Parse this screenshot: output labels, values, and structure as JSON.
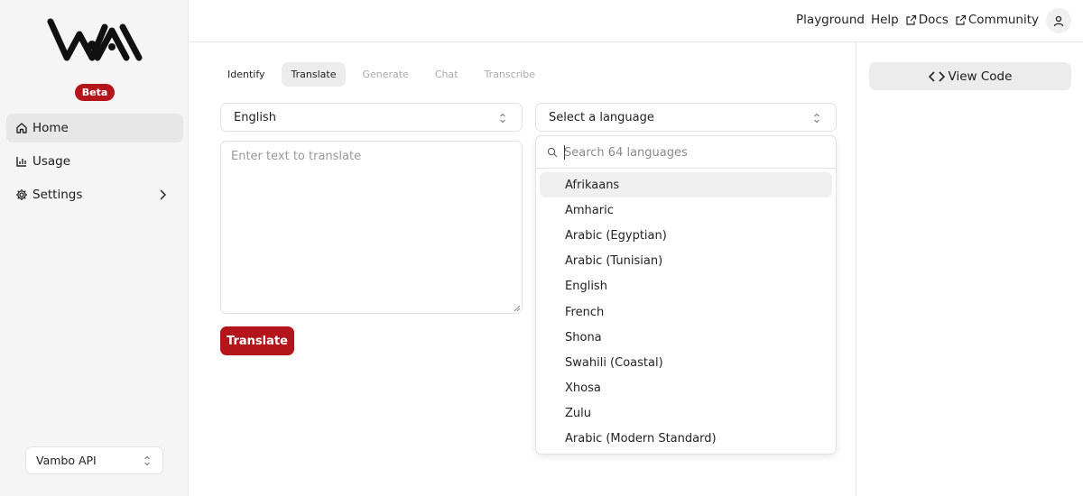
{
  "sidebar": {
    "beta_badge": "Beta",
    "nav": [
      {
        "label": "Home",
        "icon": "home-icon",
        "active": true
      },
      {
        "label": "Usage",
        "icon": "bar-chart-icon"
      },
      {
        "label": "Settings",
        "icon": "gear-icon",
        "has_submenu": true
      }
    ],
    "api_select": {
      "value": "Vambo API"
    }
  },
  "header": {
    "links": [
      {
        "label": "Playground",
        "external": false
      },
      {
        "label": "Help",
        "external": false
      },
      {
        "label": "Docs",
        "external": true
      },
      {
        "label": "Community",
        "external": true
      }
    ]
  },
  "right_panel": {
    "view_code_label": "View Code"
  },
  "tabs": [
    {
      "label": "Identify",
      "state": "enabled"
    },
    {
      "label": "Translate",
      "state": "active"
    },
    {
      "label": "Generate",
      "state": "disabled"
    },
    {
      "label": "Chat",
      "state": "disabled"
    },
    {
      "label": "Transcribe",
      "state": "disabled"
    }
  ],
  "translate": {
    "source_language": "English",
    "target_language_placeholder": "Select a language",
    "input_placeholder": "Enter text to translate",
    "input_value": "",
    "button_label": "Translate"
  },
  "language_dropdown": {
    "search_placeholder": "Search 64 languages",
    "options": [
      "Afrikaans",
      "Amharic",
      "Arabic (Egyptian)",
      "Arabic (Tunisian)",
      "English",
      "French",
      "Shona",
      "Swahili (Coastal)",
      "Xhosa",
      "Zulu",
      "Arabic (Modern Standard)"
    ],
    "highlighted": "Afrikaans"
  },
  "colors": {
    "brand_red": "#b4151b",
    "sidebar_bg": "#f5f5f5"
  }
}
